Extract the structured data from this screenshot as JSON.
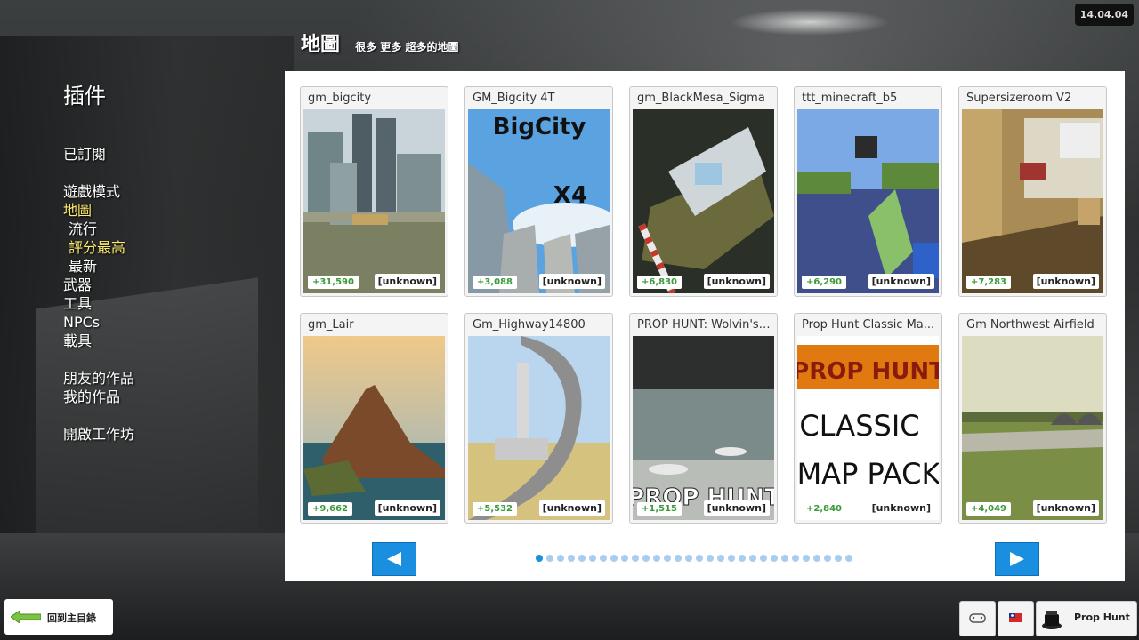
{
  "clock": "14.04.04",
  "sidebar": {
    "title": "插件",
    "items": {
      "subscribed": "已訂閱",
      "gamemodes": "遊戲模式",
      "maps": "地圖",
      "popular": "流行",
      "top_rated": "評分最高",
      "latest": "最新",
      "weapons": "武器",
      "tools": "工具",
      "npcs": "NPCs",
      "vehicles": "載具",
      "friends_works": "朋友的作品",
      "my_works": "我的作品",
      "open_workshop": "開啟工作坊"
    }
  },
  "header": {
    "title": "地圖",
    "subtitle": "很多 更多 超多的地圖"
  },
  "cards": [
    {
      "title": "gm_bigcity",
      "votes": "+31,590",
      "tag": "[unknown]"
    },
    {
      "title": "GM_Bigcity 4T",
      "votes": "+3,088",
      "tag": "[unknown]",
      "art_a": "BigCity",
      "art_b": "X4"
    },
    {
      "title": "gm_BlackMesa_Sigma",
      "votes": "+6,830",
      "tag": "[unknown]"
    },
    {
      "title": "ttt_minecraft_b5",
      "votes": "+6,290",
      "tag": "[unknown]"
    },
    {
      "title": "Supersizeroom V2",
      "votes": "+7,283",
      "tag": "[unknown]"
    },
    {
      "title": "gm_Lair",
      "votes": "+9,662",
      "tag": "[unknown]"
    },
    {
      "title": "Gm_Highway14800",
      "votes": "+5,532",
      "tag": "[unknown]"
    },
    {
      "title": "PROP HUNT: Wolvin's ...",
      "votes": "+1,515",
      "tag": "[unknown]",
      "art_a": "PROP HUNT"
    },
    {
      "title": "Prop Hunt Classic Ma...",
      "votes": "+2,840",
      "tag": "[unknown]",
      "art_a": "PROP HUNT",
      "art_b": "CLASSIC",
      "art_c": "MAP PACK"
    },
    {
      "title": "Gm Northwest Airfield",
      "votes": "+4,049",
      "tag": "[unknown]"
    }
  ],
  "pagination": {
    "total": 30,
    "current": 1
  },
  "colors": {
    "accent": "#1a8fe0",
    "active": "#ffeb6b",
    "votes": "#3a9a3a"
  },
  "bottom": {
    "back_label": "回到主目錄",
    "gamemode_label": "Prop Hunt",
    "icons": [
      "back-arrow-icon",
      "controller-icon",
      "taiwan-flag-icon",
      "gamemode-icon"
    ]
  }
}
